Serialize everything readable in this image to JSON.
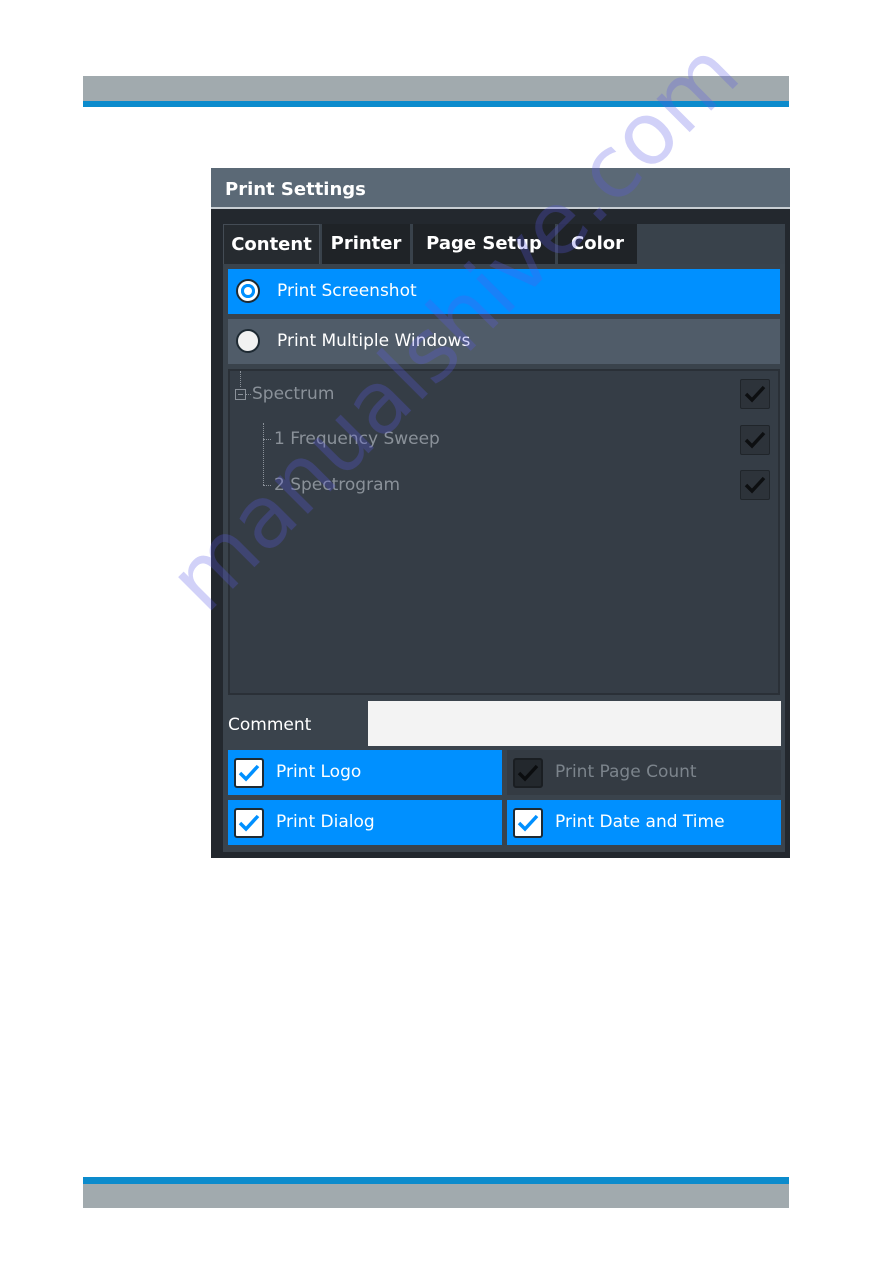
{
  "dialog": {
    "title": "Print Settings",
    "tabs": [
      {
        "label": "Content",
        "active": true
      },
      {
        "label": "Printer",
        "active": false
      },
      {
        "label": "Page Setup",
        "active": false
      },
      {
        "label": "Color",
        "active": false
      }
    ],
    "mode_options": [
      {
        "label": "Print Screenshot",
        "selected": true
      },
      {
        "label": "Print Multiple Windows",
        "selected": false
      }
    ],
    "tree": {
      "root": {
        "label": "Spectrum",
        "checked": true,
        "expanded": true
      },
      "children": [
        {
          "label": "1 Frequency Sweep",
          "checked": true
        },
        {
          "label": "2 Spectrogram",
          "checked": true
        }
      ]
    },
    "comment": {
      "label": "Comment",
      "value": ""
    },
    "options": [
      {
        "label": "Print Logo",
        "checked": true,
        "enabled": true
      },
      {
        "label": "Print Page Count",
        "checked": true,
        "enabled": false
      },
      {
        "label": "Print Dialog",
        "checked": true,
        "enabled": true
      },
      {
        "label": "Print Date and Time",
        "checked": true,
        "enabled": true
      }
    ]
  },
  "colors": {
    "accent": "#0090ff",
    "page_rule": "#0c8bcc",
    "page_band": "#a1aaae",
    "title_bar": "#5b6976"
  },
  "watermark": "manualshive.com"
}
